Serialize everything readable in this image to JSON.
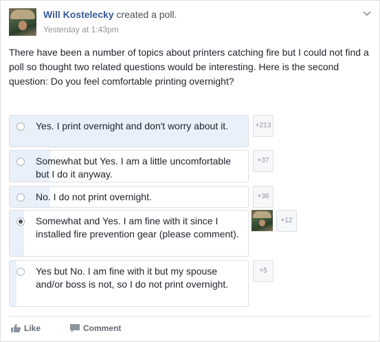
{
  "post": {
    "author": "Will Kostelecky",
    "action": " created a poll.",
    "timestamp": "Yesterday at 1:43pm",
    "text": "There have been a number of topics about printers catching fire but I could not find a poll so thought two related questions would be interesting. Here is the second question: Do you feel comfortable printing overnight?"
  },
  "poll": {
    "options": [
      {
        "label": "Yes. I print overnight and don't worry about it.",
        "votes": "+213",
        "fill": 1.0,
        "selected": false
      },
      {
        "label": "Somewhat but Yes. I am a little uncomfortable but I do it anyway.",
        "votes": "+37",
        "fill": 0.17,
        "selected": false
      },
      {
        "label": "No. I do not print overnight.",
        "votes": "+36",
        "fill": 0.17,
        "selected": false
      },
      {
        "label": "Somewhat and Yes. I am fine with it since I installed fire prevention gear (please comment).",
        "votes": "+12",
        "fill": 0.06,
        "selected": true
      },
      {
        "label": "Yes but No. I am fine with it but my spouse and/or boss is not, so I do not print overnight.",
        "votes": "+5",
        "fill": 0.03,
        "selected": false
      }
    ]
  },
  "actions": {
    "like": "Like",
    "comment": "Comment"
  },
  "icons": {
    "options_menu": "chevron-down-icon",
    "like": "thumbs-up-icon",
    "comment": "comment-bubble-icon"
  },
  "colors": {
    "author_link": "#365899",
    "poll_fill": "#e9f0fa",
    "border": "#dddfe2"
  }
}
